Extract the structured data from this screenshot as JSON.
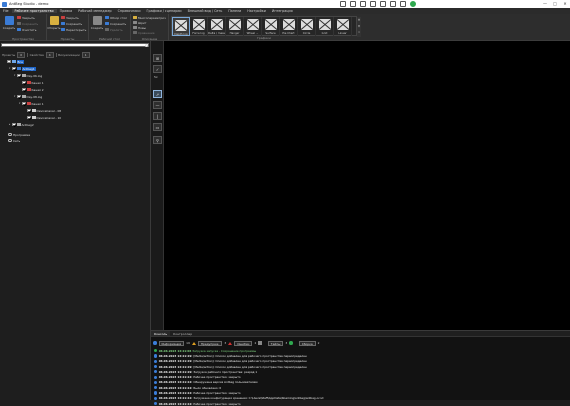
{
  "window": {
    "title": "AntBeg Studio - demo",
    "controls": [
      "—",
      "□",
      "✕"
    ]
  },
  "menu": {
    "items": [
      "File",
      "Рабочее пространство",
      "Правка",
      "Рабочий менеджер",
      "Справочники",
      "Графики / сценарии",
      "Внешний вид / Сеть",
      "Панели",
      "Настройки",
      "Интеграция"
    ],
    "active_index": 1
  },
  "ribbon": {
    "groups": [
      {
        "label": "Пространство",
        "big": {
          "label": "Создать"
        },
        "small": [
          "Закрыть",
          "Сохранить",
          "Очистить"
        ],
        "small_disabled": [
          false,
          true,
          false
        ]
      },
      {
        "label": "Проекты",
        "big": {
          "label": "Открыть"
        },
        "small": [
          "Закрыть",
          "Сохранить",
          "Переоткрыть"
        ],
        "small_disabled": [
          false,
          false,
          false
        ]
      },
      {
        "label": "Рабочий стол",
        "big": {
          "label": "Создать"
        },
        "small": [
          "Обзор стол",
          "Сохранить",
          "Удалить"
        ],
        "small_disabled": [
          false,
          false,
          true
        ]
      },
      {
        "label": "Описание",
        "small": [
          "Многопараметрич",
          "Шрит",
          "Новы",
          "Сравнение"
        ],
        "small_disabled": [
          false,
          false,
          false,
          true
        ]
      }
    ],
    "gallery": {
      "label": "Графики",
      "items": [
        "Depth log",
        "Force log",
        "Delta / mass",
        "Hanger",
        "Wheel ...",
        "Surface",
        "Pie Chart",
        "Circle",
        "Grid",
        "Linear"
      ],
      "selected_index": 0
    }
  },
  "left_panel": {
    "search_placeholder": "",
    "filters": [
      {
        "label": "Проекты",
        "count": "0"
      },
      {
        "label": "Свойства",
        "count": "4"
      },
      {
        "label": "Визуализации",
        "count": "1"
      }
    ],
    "tree": [
      {
        "label": "Все",
        "level": 0,
        "twisty": "",
        "checked": false,
        "icon": "#6da6e8",
        "selected": true
      },
      {
        "label": "Antbeg1",
        "level": 1,
        "twisty": "▾",
        "checked": true,
        "icon": "#3a7bd5",
        "selected": true
      },
      {
        "label": "Day-06.log",
        "level": 2,
        "twisty": "▾",
        "checked": true,
        "icon": "#aaaaaa",
        "selected": false
      },
      {
        "label": "Канал 1",
        "level": 3,
        "twisty": "",
        "checked": true,
        "icon": "#c94040",
        "selected": false
      },
      {
        "label": "Канал 2",
        "level": 3,
        "twisty": "",
        "checked": true,
        "icon": "#c94040",
        "selected": false
      },
      {
        "label": "Day-08.log",
        "level": 2,
        "twisty": "▾",
        "checked": true,
        "icon": "#aaaaaa",
        "selected": false
      },
      {
        "label": "Канал 1",
        "level": 3,
        "twisty": "▾",
        "checked": true,
        "icon": "#c94040",
        "selected": false
      },
      {
        "label": "DeviceCanal - 08",
        "level": 4,
        "twisty": "",
        "checked": true,
        "icon": "#cccccc",
        "selected": false
      },
      {
        "label": "DeviceCanal - 10",
        "level": 4,
        "twisty": "",
        "checked": true,
        "icon": "#cccccc",
        "selected": false
      },
      {
        "label": "Antbeg2",
        "level": 1,
        "twisty": "▸",
        "checked": true,
        "icon": "#aaaaaa",
        "selected": false
      }
    ],
    "radios": [
      "Программа",
      "Сеть"
    ]
  },
  "tools": [
    {
      "name": "grid-tool",
      "glyph": "⊞"
    },
    {
      "name": "check-tool",
      "glyph": "✓"
    },
    {
      "name": "pointer-tool",
      "glyph": "➚"
    },
    {
      "name": "hline-tool",
      "glyph": "—"
    },
    {
      "name": "vline-tool",
      "glyph": "|"
    },
    {
      "name": "window-tool",
      "glyph": "▭"
    },
    {
      "name": "pin-tool",
      "glyph": "⚲"
    }
  ],
  "tool_label": "5x",
  "bottom_panel": {
    "tabs": [
      "Консоль",
      "Контроллер"
    ],
    "active_tab": 0,
    "bar": {
      "info_label": "Информация",
      "info_count": "19",
      "warn_label": "Предупреж.",
      "warn_count": "3",
      "error_label": "Ошибки",
      "error_count": "2",
      "debug_label": "Тайпы",
      "debug_count": "3",
      "other_label": "Сборка",
      "other_count": "2"
    },
    "lines": [
      {
        "ts": "06.06.2023 14:21:06",
        "msg": "Загрузка запуска - Сохранение программы"
      },
      {
        "ts": "06.06.2023 14:21:29:",
        "msg": "[Media/action]: Список добавлен для рабочего пространства переопределен"
      },
      {
        "ts": "06.06.2023 14:21:29:",
        "msg": "[Media/action]: Список добавлен для рабочего пространства переопределен"
      },
      {
        "ts": "06.06.2023 14:21:29:",
        "msg": "[Media/action]: Список добавлен для рабочего пространства переопределен"
      },
      {
        "ts": "06.06.2023 14:21:29:",
        "msg": "Загрузка рабочего пространства: разряд 1"
      },
      {
        "ts": "06.06.2023 14:21:22:",
        "msg": "Рабочее пространство: закрыто"
      },
      {
        "ts": "06.06.2023 14:21:22:",
        "msg": "Обнаружена версия Antbeg пользователем"
      },
      {
        "ts": "06.06.2023 14:21:22:",
        "msg": "Было обновлено: 0"
      },
      {
        "ts": "06.06.2023 14:21:22:",
        "msg": "Рабочее пространство: закрыто"
      },
      {
        "ts": "06.06.2023 14:21:22:",
        "msg": "Загружена конфигурация хранения: C:\\Users\\Staff\\AppData\\Roaming\\antbeg\\antbeg.ocnd"
      },
      {
        "ts": "06.06.2023 14:21:22:",
        "msg": "Рабочее пространство: закрыто"
      }
    ]
  },
  "colors": {
    "accent": "#1c64c8",
    "canvas": "#000000",
    "info": "#3b7dd8",
    "warning": "#e0a020",
    "error": "#d03030",
    "success": "#2fa84f"
  }
}
